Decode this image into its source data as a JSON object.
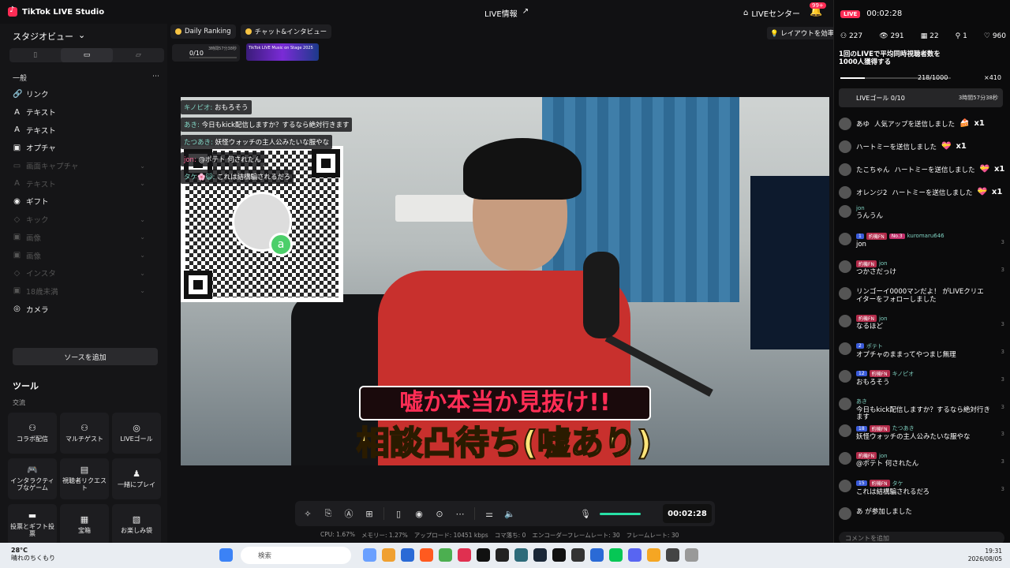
{
  "app": {
    "title": "TikTok LIVE Studio",
    "live_info": "LIVE情報",
    "live_center": "LIVEセンター",
    "notif_badge": "99+"
  },
  "sidebar": {
    "studio_view": "スタジオビュー",
    "group_label": "一般",
    "sources": [
      {
        "icon": "🔗",
        "label": "リンク",
        "dim": false
      },
      {
        "icon": "A",
        "label": "テキスト",
        "dim": false
      },
      {
        "icon": "A",
        "label": "テキスト",
        "dim": false
      },
      {
        "icon": "▣",
        "label": "オプチャ",
        "dim": false
      },
      {
        "icon": "▭",
        "label": "画面キャプチャ",
        "dim": true
      },
      {
        "icon": "A",
        "label": "テキスト",
        "dim": true
      },
      {
        "icon": "◉",
        "label": "ギフト",
        "dim": false
      },
      {
        "icon": "◇",
        "label": "キック",
        "dim": true
      },
      {
        "icon": "▣",
        "label": "画像",
        "dim": true
      },
      {
        "icon": "▣",
        "label": "画像",
        "dim": true
      },
      {
        "icon": "◇",
        "label": "インスタ",
        "dim": true
      },
      {
        "icon": "▣",
        "label": "18歳未満",
        "dim": true
      },
      {
        "icon": "◎",
        "label": "カメラ",
        "dim": false
      }
    ],
    "add_source": "ソースを追加",
    "tools_title": "ツール",
    "tools_sub": "交流",
    "tools": [
      {
        "icon": "⚇",
        "label": "コラボ配信"
      },
      {
        "icon": "⚇",
        "label": "マルチゲスト"
      },
      {
        "icon": "◎",
        "label": "LIVEゴール"
      },
      {
        "icon": "🎮",
        "label": "インタラクティブなゲーム"
      },
      {
        "icon": "▤",
        "label": "視聴者リクエスト"
      },
      {
        "icon": "♟",
        "label": "一緒にプレイ"
      },
      {
        "icon": "▬",
        "label": "投票とギフト投票"
      },
      {
        "icon": "▦",
        "label": "宝箱"
      },
      {
        "icon": "▧",
        "label": "お楽しみ袋"
      }
    ]
  },
  "center": {
    "chip_ranking": "Daily Ranking",
    "chip_chat": "チャット&インタビュー",
    "goal_mini": "0/10",
    "goal_mini_time": "3時間57分38秒",
    "promo_text": "TikTok LIVE Music on Stage 2025",
    "layout_hint": "レイアウトを効率化",
    "overlay_chat": [
      {
        "name": "キノピオ:",
        "text": "おもろそう",
        "pink": false
      },
      {
        "name": "あき:",
        "text": "今日もkick配信しますか？するなら絶対行きます",
        "pink": false
      },
      {
        "name": "たつあき:",
        "text": "妖怪ウォッチの主人公みたいな服やな",
        "pink": false
      },
      {
        "name": "jon:",
        "text": "@ポテト 何されたん",
        "pink": true
      },
      {
        "name": "タケ🌸😺:",
        "text": "これは結構騙されるだろ",
        "pink": false
      }
    ],
    "caption_top": "嘘か本当か見抜け!!",
    "caption_main": "相談凸待ち(嘘あり)",
    "timer": "00:02:28",
    "stats": {
      "cpu": "CPU: 1.67%",
      "mem": "メモリー: 1.27%",
      "upload": "アップロード: 10451 kbps",
      "drop": "コマ落ち: 0",
      "enc": "エンコーダーフレームレート: 30",
      "fps": "フレームレート: 30"
    }
  },
  "right": {
    "live_label": "LIVE",
    "time": "00:02:28",
    "stats": [
      "227",
      "291",
      "22",
      "1",
      "960"
    ],
    "goal_text": "1回のLIVEで平均同時視聴者数を1000人獲得する",
    "goal_count": "218/1000",
    "goal_gift": "×410",
    "goal_row_label": "LIVEゴール 0/10",
    "goal_row_time": "3時間57分38秒",
    "gifts": [
      {
        "name": "あゆ",
        "text": "人気アップを送信しました",
        "gi": "🍰",
        "count": "x1"
      },
      {
        "name": "",
        "text": "ハートミーを送信しました",
        "gi": "💝",
        "count": "x1"
      },
      {
        "name": "たこちゃん",
        "text": "ハートミーを送信しました",
        "gi": "💝",
        "count": "x1"
      },
      {
        "name": "オレンジ2",
        "text": "ハートミーを送信しました",
        "gi": "💝",
        "count": "x1"
      }
    ],
    "comments": [
      {
        "meta": [
          "jon"
        ],
        "tags": [],
        "msg": "うんうん",
        "n": ""
      },
      {
        "meta": [
          "kuromaru646"
        ],
        "tags": [
          "1",
          "約機FN",
          "No.3"
        ],
        "msg": "jon",
        "n": "3"
      },
      {
        "meta": [
          "jon"
        ],
        "tags": [
          "約機FN"
        ],
        "msg": "つかさだっけ",
        "n": "3"
      },
      {
        "meta": [
          ""
        ],
        "tags": [],
        "msg": "リンゴーイ0000マンだよ！ がLIVEクリエイターをフォローしました",
        "n": ""
      },
      {
        "meta": [
          "jon"
        ],
        "tags": [
          "約機FN"
        ],
        "msg": "なるほど",
        "n": "3"
      },
      {
        "meta": [
          "ポテト"
        ],
        "tags": [
          "2"
        ],
        "msg": "オプチャのままってやつまじ無理",
        "n": "3"
      },
      {
        "meta": [
          "キノピオ"
        ],
        "tags": [
          "12",
          "約機FN"
        ],
        "msg": "おもろそう",
        "n": "3"
      },
      {
        "meta": [
          "あき"
        ],
        "tags": [],
        "msg": "今日もkick配信しますか？するなら絶対行きます",
        "n": "3"
      },
      {
        "meta": [
          "たつあき"
        ],
        "tags": [
          "18",
          "約機FN"
        ],
        "msg": "妖怪ウォッチの主人公みたいな服やな",
        "n": "3"
      },
      {
        "meta": [
          "jon"
        ],
        "tags": [
          "約機FN"
        ],
        "msg": "@ポテト 何されたん",
        "n": "3"
      },
      {
        "meta": [
          "タケ"
        ],
        "tags": [
          "15",
          "約機FN"
        ],
        "msg": "これは結構騙されるだろ",
        "n": "3"
      },
      {
        "meta": [
          ""
        ],
        "tags": [],
        "msg": "あ が参加しました",
        "n": ""
      }
    ],
    "comment_placeholder": "コメントを追加"
  },
  "taskbar": {
    "temp": "28°C",
    "weather": "晴れのちくもり",
    "weather_badge": "9+",
    "search_placeholder": "検索",
    "time": "19:31",
    "date": "2026/08/05"
  }
}
